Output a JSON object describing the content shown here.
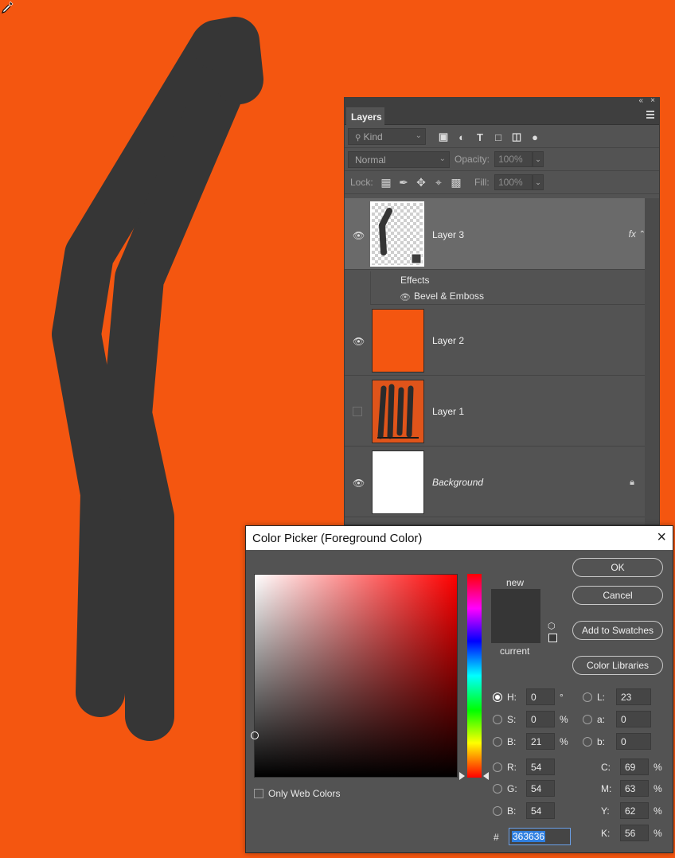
{
  "layers_panel": {
    "collapse_glyph": "«",
    "close_glyph": "×",
    "tab_label": "Layers",
    "filter_placeholder": "Kind",
    "blend_mode": "Normal",
    "opacity_label": "Opacity:",
    "opacity_value": "100%",
    "lock_label": "Lock:",
    "fill_label": "Fill:",
    "fill_value": "100%",
    "layers": [
      {
        "name": "Layer 3",
        "visible": true,
        "selected": true,
        "fx": "fx"
      },
      {
        "name": "Layer 2",
        "visible": true,
        "selected": false
      },
      {
        "name": "Layer 1",
        "visible": false,
        "selected": false
      },
      {
        "name": "Background",
        "visible": true,
        "selected": false,
        "locked": true
      }
    ],
    "effects_label": "Effects",
    "effect_items": [
      "Bevel & Emboss"
    ]
  },
  "color_picker": {
    "title": "Color Picker (Foreground Color)",
    "new_label": "new",
    "current_label": "current",
    "buttons": {
      "ok": "OK",
      "cancel": "Cancel",
      "add_to_swatches": "Add to Swatches",
      "color_libraries": "Color Libraries"
    },
    "only_web_colors": "Only Web Colors",
    "hsb": {
      "h_label": "H:",
      "h": "0",
      "h_unit": "°",
      "s_label": "S:",
      "s": "0",
      "s_unit": "%",
      "b_label": "B:",
      "b": "21",
      "b_unit": "%"
    },
    "lab": {
      "l_label": "L:",
      "l": "23",
      "a_label": "a:",
      "a": "0",
      "b_label": "b:",
      "b": "0"
    },
    "rgb": {
      "r_label": "R:",
      "r": "54",
      "g_label": "G:",
      "g": "54",
      "b_label": "B:",
      "b": "54"
    },
    "cmyk": {
      "c_label": "C:",
      "c": "69",
      "m_label": "M:",
      "m": "63",
      "y_label": "Y:",
      "y": "62",
      "k_label": "K:",
      "k": "56",
      "unit": "%"
    },
    "hex_label": "#",
    "hex": "363636",
    "selected_color": "#363636"
  },
  "colors": {
    "canvas_background": "#f45610",
    "stroke": "#363636"
  }
}
